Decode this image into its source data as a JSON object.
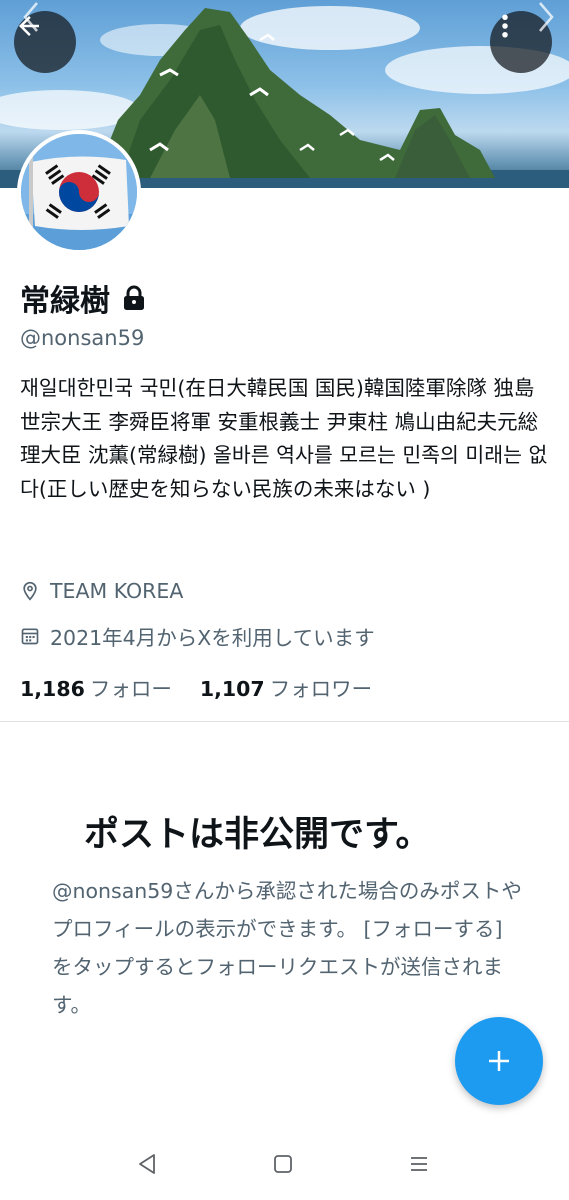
{
  "header": {
    "banner_image": "island-rocks-banner",
    "back_icon": "arrow-left-icon",
    "more_icon": "more-vertical-icon",
    "prev_icon": "chevron-left-icon",
    "next_icon": "chevron-right-icon"
  },
  "profile": {
    "avatar": "korean-flag-avatar",
    "name": "常緑樹",
    "lock_icon": "lock-icon",
    "handle": "@nonsan59",
    "bio": "재일대한민국 국민(在日大韓民国 国民)韓国陸軍除隊 独島 世宗大王 李舜臣将軍 安重根義士 尹東柱 鳩山由紀夫元総理大臣 沈薫(常緑樹) 올바른 역사를 모르는 민족의 미래는 없다(正しい歴史を知らない民族の未来はない )",
    "location": "TEAM KOREA",
    "joined": "2021年4月からXを利用しています",
    "following_count": "1,186",
    "following_label": "フォロー",
    "followers_count": "1,107",
    "followers_label": "フォロワー"
  },
  "private_notice": {
    "title": "ポストは非公開です。",
    "description": "@nonsan59さんから承認された場合のみポストやプロフィールの表示ができます。 [フォローする] をタップするとフォローリクエストが送信されます。"
  },
  "fab": {
    "icon": "plus-icon"
  },
  "system_nav": {
    "back_icon": "nav-back-icon",
    "home_icon": "nav-home-icon",
    "recents_icon": "nav-recents-icon"
  },
  "colors": {
    "accent": "#1d9bf0",
    "text_primary": "#0f1419",
    "text_secondary": "#536471"
  }
}
